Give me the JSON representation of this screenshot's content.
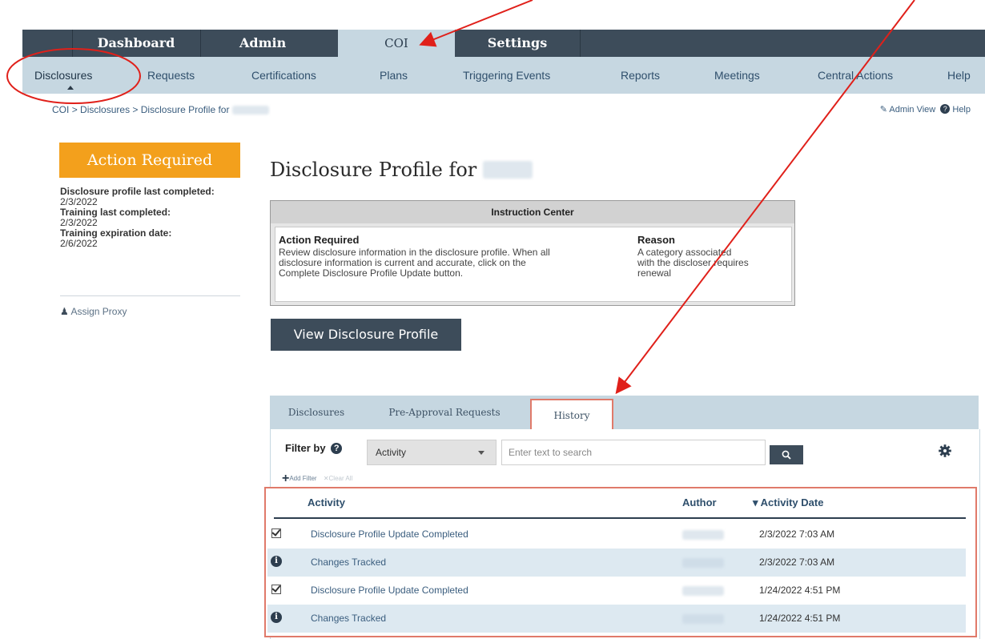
{
  "top_tabs": [
    "Dashboard",
    "Admin",
    "COI",
    "Settings"
  ],
  "sub_nav": [
    "Disclosures",
    "Requests",
    "Certifications",
    "Plans",
    "Triggering Events",
    "Reports",
    "Meetings",
    "Central Actions",
    "Help"
  ],
  "breadcrumb": {
    "coi": "COI",
    "sep": ">",
    "disclosures": "Disclosures",
    "profile": "Disclosure Profile for"
  },
  "admin_links": {
    "admin_view": "Admin View",
    "help": "Help"
  },
  "left_panel": {
    "action_required": "Action Required",
    "profile_label": "Disclosure profile last completed:",
    "profile_date": "2/3/2022",
    "training_label": "Training last completed:",
    "training_date": "2/3/2022",
    "expiration_label": "Training expiration date:",
    "expiration_date": "2/6/2022",
    "assign_proxy": "Assign Proxy"
  },
  "page_title": "Disclosure Profile for",
  "instruction_center": {
    "title": "Instruction Center",
    "action_header": "Action Required",
    "action_text_1": "Review disclosure information in the disclosure profile. When all",
    "action_text_2": "disclosure information is current and accurate, click on the",
    "action_text_3": "Complete Disclosure Profile Update button.",
    "reason_header": "Reason",
    "reason_text_1": "A category associated",
    "reason_text_2": "with the discloser requires",
    "reason_text_3": "renewal"
  },
  "view_button": "View Disclosure Profile",
  "panel_tabs": [
    "Disclosures",
    "Pre-Approval Requests",
    "History"
  ],
  "filter": {
    "label": "Filter by",
    "select_value": "Activity",
    "search_placeholder": "Enter text to search",
    "add_filter": "Add Filter",
    "clear_all": "Clear All"
  },
  "table": {
    "headers": {
      "activity": "Activity",
      "author": "Author",
      "date": "Activity Date"
    },
    "sort_marker": "▾",
    "rows": [
      {
        "icon": "check",
        "activity": "Disclosure Profile Update Completed",
        "date": "2/3/2022 7:03 AM"
      },
      {
        "icon": "info",
        "activity": "Changes Tracked",
        "date": "2/3/2022 7:03 AM"
      },
      {
        "icon": "check",
        "activity": "Disclosure Profile Update Completed",
        "date": "1/24/2022 4:51 PM"
      },
      {
        "icon": "info",
        "activity": "Changes Tracked",
        "date": "1/24/2022 4:51 PM"
      }
    ]
  },
  "colors": {
    "nav_dark": "#3d4c5a",
    "nav_light": "#c6d7e1",
    "action_orange": "#f3a01c",
    "annotation_red": "#e0201a",
    "highlight_box": "#e07a6a"
  }
}
